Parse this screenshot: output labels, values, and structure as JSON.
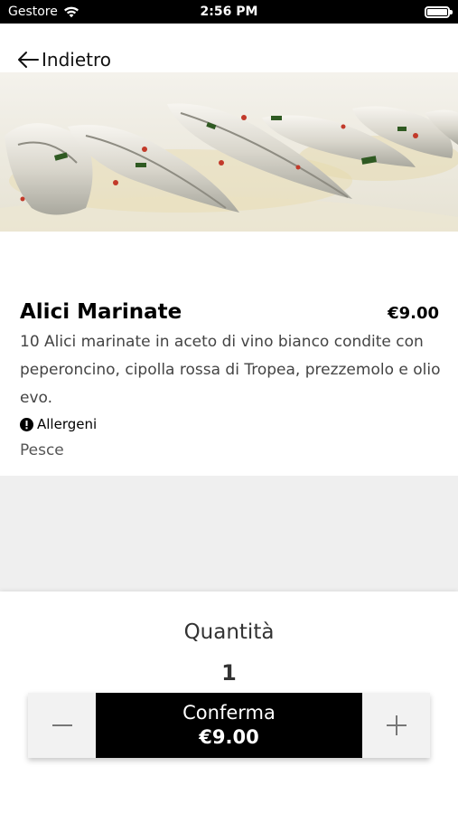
{
  "status_bar": {
    "carrier": "Gestore",
    "time": "2:56 PM",
    "battery_level": 1.0
  },
  "nav": {
    "back_label": "Indietro",
    "back_icon": "arrow-left-icon"
  },
  "dish": {
    "name": "Alici Marinate",
    "price": "€9.00",
    "description": "10 Alici marinate in aceto di vino bianco condite con peperoncino, cipolla rossa di Tropea, prezzemolo e olio evo.",
    "allergens_label": "Allergeni",
    "allergens_icon": "alert-circle-icon",
    "allergens_value": "Pesce"
  },
  "order": {
    "quantity_label": "Quantità",
    "quantity": "1",
    "decrement_icon": "minus-icon",
    "increment_icon": "plus-icon",
    "confirm_label": "Conferma",
    "confirm_price": "€9.00"
  },
  "colors": {
    "primary_button": "#000000",
    "stepper_background": "#f2f2f2",
    "grey_band": "#efefef"
  }
}
